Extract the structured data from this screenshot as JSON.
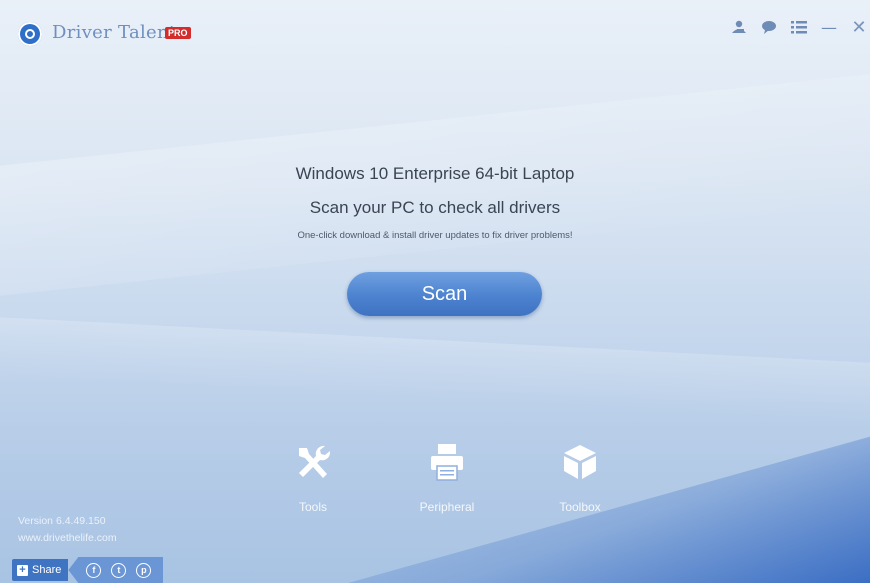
{
  "app": {
    "title": "Driver Talent",
    "badge": "PRO"
  },
  "toolbar": {
    "icons": [
      "user-icon",
      "chat-icon",
      "menu-icon",
      "minimize-icon",
      "close-icon"
    ],
    "minimize_glyph": "—",
    "close_glyph": "✕"
  },
  "main": {
    "system_info": "Windows 10 Enterprise 64-bit Laptop",
    "headline": "Scan your PC to check all drivers",
    "subline": "One-click download & install driver updates to fix driver problems!",
    "scan_label": "Scan"
  },
  "tools": [
    {
      "label": "Tools",
      "icon": "tools-icon"
    },
    {
      "label": "Peripheral",
      "icon": "printer-icon"
    },
    {
      "label": "Toolbox",
      "icon": "box-icon"
    }
  ],
  "footer": {
    "version": "Version 6.4.49.150",
    "website": "www.drivethelife.com",
    "share_label": "Share",
    "social": [
      "facebook-icon",
      "twitter-icon",
      "pinterest-icon"
    ],
    "social_glyphs": [
      "f",
      "t",
      "p"
    ]
  },
  "colors": {
    "accent": "#4c82cf",
    "badge": "#d32c2c",
    "share": "#3f74c2"
  }
}
